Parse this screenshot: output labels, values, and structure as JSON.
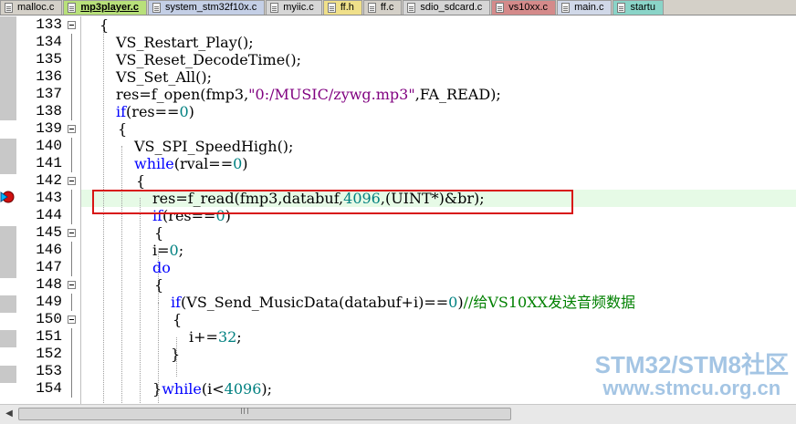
{
  "tabs": [
    {
      "label": "malloc.c",
      "color": "#d4d0c8",
      "active": false
    },
    {
      "label": "mp3player.c",
      "color": "#b8e07a",
      "active": true
    },
    {
      "label": "system_stm32f10x.c",
      "color": "#c4cfe6",
      "active": false
    },
    {
      "label": "myiic.c",
      "color": "#d6d6d6",
      "active": false
    },
    {
      "label": "ff.h",
      "color": "#f0e08a",
      "active": false
    },
    {
      "label": "ff.c",
      "color": "#d4d0c8",
      "active": false
    },
    {
      "label": "sdio_sdcard.c",
      "color": "#d6d6d6",
      "active": false
    },
    {
      "label": "vs10xx.c",
      "color": "#d48a8a",
      "active": false
    },
    {
      "label": "main.c",
      "color": "#d0d8e8",
      "active": false
    },
    {
      "label": "startu",
      "color": "#8ad4c8",
      "active": false
    }
  ],
  "lines": [
    {
      "num": "133",
      "segs": [
        [
          "{",
          ""
        ]
      ],
      "indent": 109
    },
    {
      "num": "134",
      "segs": [
        [
          "VS_Restart_Play();",
          ""
        ]
      ],
      "indent": 127
    },
    {
      "num": "135",
      "segs": [
        [
          "VS_Reset_DecodeTime();",
          ""
        ]
      ],
      "indent": 127
    },
    {
      "num": "136",
      "segs": [
        [
          "VS_Set_All();",
          ""
        ]
      ],
      "indent": 127
    },
    {
      "num": "137",
      "segs": [
        [
          "res=f_open(fmp3,",
          ""
        ],
        [
          "\"0:/MUSIC/zywg.mp3\"",
          "str"
        ],
        [
          ",FA_READ);",
          ""
        ]
      ],
      "indent": 127
    },
    {
      "num": "138",
      "segs": [
        [
          "if",
          "kw"
        ],
        [
          "(res==",
          ""
        ],
        [
          "0",
          "num"
        ],
        [
          ")",
          ""
        ]
      ],
      "indent": 127
    },
    {
      "num": "139",
      "segs": [
        [
          "{",
          ""
        ]
      ],
      "indent": 129
    },
    {
      "num": "140",
      "segs": [
        [
          "VS_SPI_SpeedHigh();",
          ""
        ]
      ],
      "indent": 147
    },
    {
      "num": "141",
      "segs": [
        [
          "while",
          "kw"
        ],
        [
          "(rval==",
          ""
        ],
        [
          "0",
          "num"
        ],
        [
          ")",
          ""
        ]
      ],
      "indent": 147
    },
    {
      "num": "142",
      "segs": [
        [
          "{",
          ""
        ]
      ],
      "indent": 149
    },
    {
      "num": "143",
      "segs": [
        [
          "res=f_read(fmp3,databuf,",
          ""
        ],
        [
          "4096",
          "num"
        ],
        [
          ",(UINT*)&br);",
          ""
        ]
      ],
      "indent": 167
    },
    {
      "num": "144",
      "segs": [
        [
          "if",
          "kw"
        ],
        [
          "(res==",
          ""
        ],
        [
          "0",
          "num"
        ],
        [
          ")",
          ""
        ]
      ],
      "indent": 167
    },
    {
      "num": "145",
      "segs": [
        [
          "{",
          ""
        ]
      ],
      "indent": 169
    },
    {
      "num": "146",
      "segs": [
        [
          "i=",
          ""
        ],
        [
          "0",
          "num"
        ],
        [
          ";",
          ""
        ]
      ],
      "indent": 167
    },
    {
      "num": "147",
      "segs": [
        [
          "do",
          "kw"
        ]
      ],
      "indent": 167
    },
    {
      "num": "148",
      "segs": [
        [
          "{",
          ""
        ]
      ],
      "indent": 169
    },
    {
      "num": "149",
      "segs": [
        [
          "if",
          "kw"
        ],
        [
          "(VS_Send_MusicData(databuf+i)==",
          ""
        ],
        [
          "0",
          "num"
        ],
        [
          ")",
          ""
        ],
        [
          "//给VS10XX发送音频数据",
          "cmt"
        ]
      ],
      "indent": 187
    },
    {
      "num": "150",
      "segs": [
        [
          "{",
          ""
        ]
      ],
      "indent": 189
    },
    {
      "num": "151",
      "segs": [
        [
          "i+=",
          ""
        ],
        [
          "32",
          "num"
        ],
        [
          ";",
          ""
        ]
      ],
      "indent": 207
    },
    {
      "num": "152",
      "segs": [
        [
          "}",
          ""
        ]
      ],
      "indent": 187
    },
    {
      "num": "153",
      "segs": [],
      "indent": 0
    },
    {
      "num": "154",
      "segs": [
        [
          "}",
          ""
        ],
        [
          "while",
          "kw"
        ],
        [
          "(i<",
          ""
        ],
        [
          "4096",
          "num"
        ],
        [
          ");",
          ""
        ]
      ],
      "indent": 167
    }
  ],
  "watermark": {
    "line1": "STM32/STM8社区",
    "line2": "www.stmcu.org.cn"
  }
}
